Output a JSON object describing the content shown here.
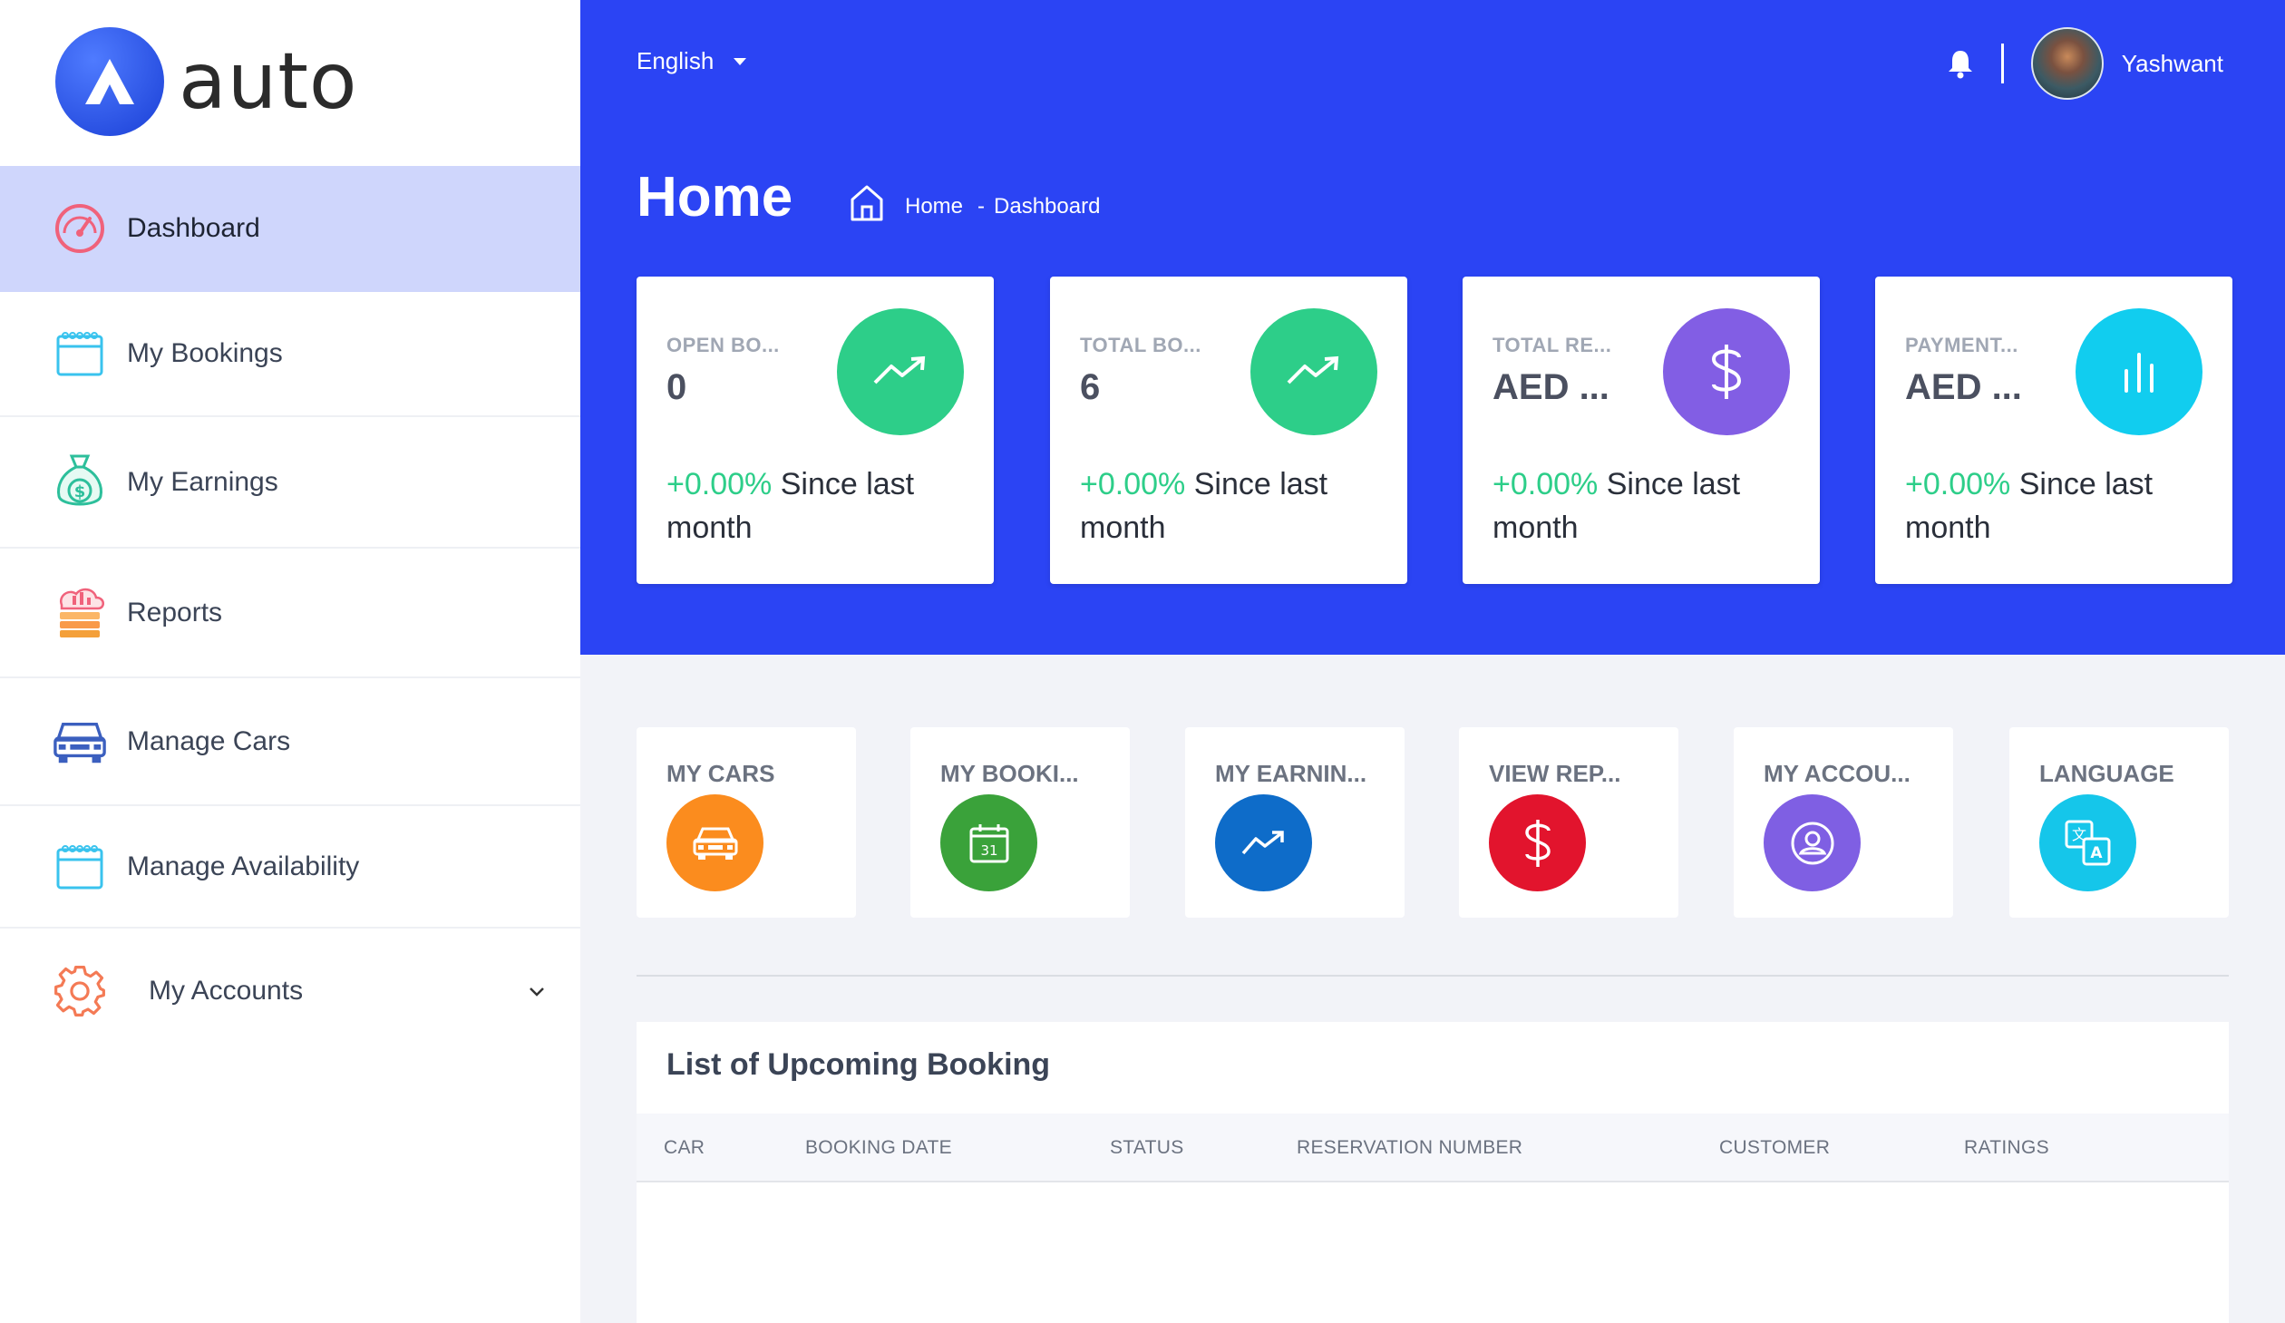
{
  "brand": {
    "name": "auto"
  },
  "sidebar": {
    "items": [
      {
        "label": "Dashboard",
        "icon": "speedometer-icon",
        "active": true
      },
      {
        "label": "My Bookings",
        "icon": "calendar-icon"
      },
      {
        "label": "My Earnings",
        "icon": "money-bag-icon"
      },
      {
        "label": "Reports",
        "icon": "reports-icon"
      },
      {
        "label": "Manage Cars",
        "icon": "car-icon"
      },
      {
        "label": "Manage Availability",
        "icon": "calendar-icon"
      },
      {
        "label": "My Accounts",
        "icon": "gear-icon"
      }
    ]
  },
  "header": {
    "language": "English",
    "username": "Yashwant",
    "title": "Home",
    "breadcrumb": {
      "home": "Home",
      "separator": "-",
      "current": "Dashboard"
    }
  },
  "stats": [
    {
      "label": "OPEN BO...",
      "value": "0",
      "change": "+0.00%",
      "since": "Since last month",
      "color": "#2dce89",
      "icon": "trend-up-icon"
    },
    {
      "label": "TOTAL BO...",
      "value": "6",
      "change": "+0.00%",
      "since": "Since last month",
      "color": "#2dce89",
      "icon": "trend-up-icon"
    },
    {
      "label": "TOTAL RE...",
      "value": "AED ...",
      "change": "+0.00%",
      "since": "Since last month",
      "color": "#825ee4",
      "icon": "dollar-icon"
    },
    {
      "label": "PAYMENT...",
      "value": "AED ...",
      "change": "+0.00%",
      "since": "Since last month",
      "color": "#11cdef",
      "icon": "bar-chart-icon"
    }
  ],
  "tiles": [
    {
      "label": "MY CARS",
      "color": "#fb8c1e",
      "icon": "car-icon"
    },
    {
      "label": "MY BOOKI...",
      "color": "#3aa23a",
      "icon": "calendar-icon"
    },
    {
      "label": "MY EARNIN...",
      "color": "#0e6cc9",
      "icon": "trend-up-icon"
    },
    {
      "label": "VIEW REP...",
      "color": "#e2142d",
      "icon": "dollar-icon"
    },
    {
      "label": "MY ACCOU...",
      "color": "#7f5fe3",
      "icon": "user-icon"
    },
    {
      "label": "LANGUAGE",
      "color": "#15c6ea",
      "icon": "translate-icon"
    }
  ],
  "table": {
    "title": "List of Upcoming Booking",
    "columns": [
      "CAR",
      "BOOKING DATE",
      "STATUS",
      "RESERVATION NUMBER",
      "CUSTOMER",
      "RATINGS"
    ]
  },
  "colors": {
    "primary": "#2b44f4",
    "active_bg": "#cfd6fc",
    "positive": "#2dce89"
  }
}
